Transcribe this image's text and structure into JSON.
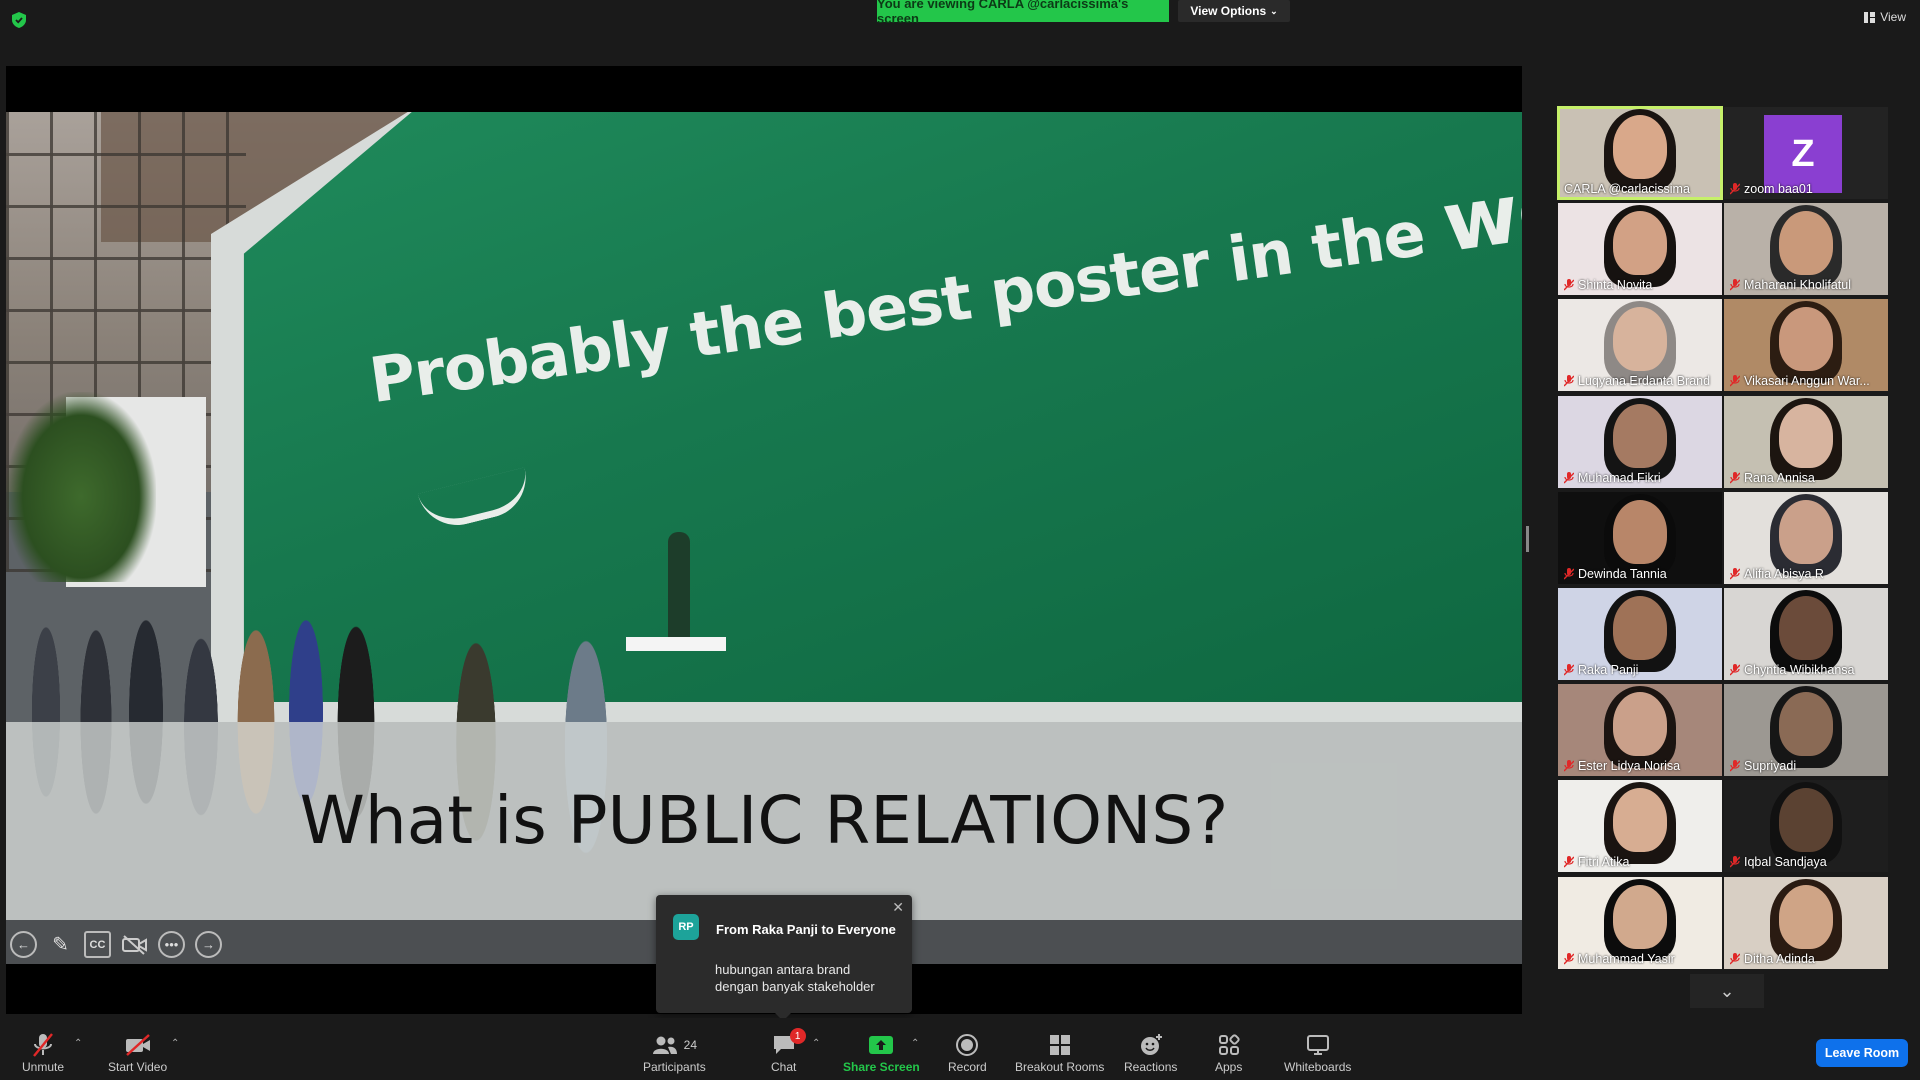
{
  "top": {
    "banner": "You are viewing CARLA @carlacissima's screen",
    "view_options": "View Options",
    "view": "View"
  },
  "slide": {
    "headline_part1": "Probably the best poster in the",
    "headline_part2": "world",
    "caption": "What is PUBLIC RELATIONS?"
  },
  "annotation_tools": [
    "back-icon",
    "pencil-icon",
    "cc-icon",
    "video-off-icon",
    "more-icon",
    "forward-icon"
  ],
  "participants": [
    {
      "name": "CARLA @carlacissima",
      "muted": false,
      "active": true,
      "skin": "#d9a88a",
      "hair": "#1a1411",
      "bg": "#c9c1b4"
    },
    {
      "name": "zoom baa01",
      "muted": true,
      "avatar_letter": "Z",
      "avatar_color": "#8a3fd1"
    },
    {
      "name": "Shinta Novita",
      "muted": true,
      "skin": "#d2a185",
      "hair": "#161210",
      "bg": "#ece3e4"
    },
    {
      "name": "Maharani Kholifatul",
      "muted": true,
      "skin": "#c9997a",
      "hair": "#2a2a2a",
      "bg": "#b9b1a8"
    },
    {
      "name": "Luqyana Erdanta Brand",
      "muted": true,
      "skin": "#d7b39c",
      "hair": "#8e8986",
      "bg": "#ece8e5"
    },
    {
      "name": "Vikasari Anggun War...",
      "muted": true,
      "skin": "#c9987c",
      "hair": "#2c1d12",
      "bg": "#b08a66"
    },
    {
      "name": "Muhamad Fikri",
      "muted": true,
      "skin": "#a57a62",
      "hair": "#141414",
      "bg": "#dcd7e3"
    },
    {
      "name": "Rana Annisa",
      "muted": true,
      "skin": "#d7b49f",
      "hair": "#1c1510",
      "bg": "#c5c0b2"
    },
    {
      "name": "Dewinda Tannia",
      "muted": true,
      "skin": "#b88669",
      "hair": "#0b0b0b",
      "bg": "#0f0f0f"
    },
    {
      "name": "Alifia Abisya R",
      "muted": true,
      "skin": "#caa08a",
      "hair": "#2b2c33",
      "bg": "#e3e0dc"
    },
    {
      "name": "Raka Panji",
      "muted": true,
      "skin": "#9f7257",
      "hair": "#121212",
      "bg": "#cfd4e6"
    },
    {
      "name": "Chyntia Wibikhansa",
      "muted": true,
      "skin": "#6b4b3a",
      "hair": "#0c0c0c",
      "bg": "#d8d6d3"
    },
    {
      "name": "Ester Lidya Norisa",
      "muted": true,
      "skin": "#caa08a",
      "hair": "#1b1411",
      "bg": "#a6877a"
    },
    {
      "name": "Supriyadi",
      "muted": true,
      "skin": "#8a6a55",
      "hair": "#161616",
      "bg": "#9c9892"
    },
    {
      "name": "Fitri Atika",
      "muted": true,
      "skin": "#d7ad92",
      "hair": "#1a1411",
      "bg": "#efeeeb"
    },
    {
      "name": "Iqbal Sandjaya",
      "muted": true,
      "skin": "#5b4232",
      "hair": "#111111",
      "bg": "#1e1e1e"
    },
    {
      "name": "Muhammad Yasir",
      "muted": true,
      "skin": "#d1a98d",
      "hair": "#0c0c0c",
      "bg": "#f0ebe3"
    },
    {
      "name": "Ditha Adinda",
      "muted": true,
      "skin": "#cfa486",
      "hair": "#2a1b12",
      "bg": "#d8cfc4"
    }
  ],
  "chat_popup": {
    "initials": "RP",
    "from": "From Raka Panji to Everyone",
    "line1": "hubungan antara brand",
    "line2": "dengan banyak stakeholder"
  },
  "toolbar": {
    "unmute": "Unmute",
    "start_video": "Start Video",
    "participants": "Participants",
    "participants_count": "24",
    "chat": "Chat",
    "chat_badge": "1",
    "share_screen": "Share Screen",
    "record": "Record",
    "breakout_rooms": "Breakout Rooms",
    "reactions": "Reactions",
    "apps": "Apps",
    "whiteboards": "Whiteboards",
    "leave_room": "Leave Room"
  },
  "colors": {
    "share_green": "#23c64a",
    "active_speaker": "#c6f06a",
    "leave_blue": "#0e71eb",
    "muted_red": "#e02828"
  }
}
